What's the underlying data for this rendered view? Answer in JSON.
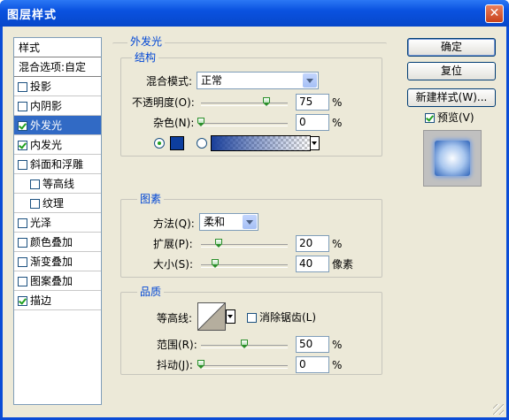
{
  "window": {
    "title": "图层样式",
    "close_glyph": "✕"
  },
  "left_panel": {
    "header": "样式",
    "blend_options": "混合选项:自定",
    "items": [
      {
        "label": "投影",
        "checked": false,
        "selected": false,
        "indent": false
      },
      {
        "label": "内阴影",
        "checked": false,
        "selected": false,
        "indent": false
      },
      {
        "label": "外发光",
        "checked": true,
        "selected": true,
        "indent": false
      },
      {
        "label": "内发光",
        "checked": true,
        "selected": false,
        "indent": false
      },
      {
        "label": "斜面和浮雕",
        "checked": false,
        "selected": false,
        "indent": false
      },
      {
        "label": "等高线",
        "checked": false,
        "selected": false,
        "indent": true
      },
      {
        "label": "纹理",
        "checked": false,
        "selected": false,
        "indent": true
      },
      {
        "label": "光泽",
        "checked": false,
        "selected": false,
        "indent": false
      },
      {
        "label": "颜色叠加",
        "checked": false,
        "selected": false,
        "indent": false
      },
      {
        "label": "渐变叠加",
        "checked": false,
        "selected": false,
        "indent": false
      },
      {
        "label": "图案叠加",
        "checked": false,
        "selected": false,
        "indent": false
      },
      {
        "label": "描边",
        "checked": true,
        "selected": false,
        "indent": false
      }
    ]
  },
  "outer_glow": {
    "title": "外发光",
    "structure": {
      "title": "结构",
      "blend_mode_label": "混合模式:",
      "blend_mode_value": "正常",
      "opacity_label": "不透明度(O):",
      "opacity_value": "75",
      "opacity_fraction": 0.75,
      "noise_label": "杂色(N):",
      "noise_value": "0",
      "noise_fraction": 0,
      "unit_percent": "%",
      "color_swatch": "#0d3e9e",
      "gradient_color": "#1a3f9a"
    },
    "elements": {
      "title": "图素",
      "technique_label": "方法(Q):",
      "technique_value": "柔和",
      "spread_label": "扩展(P):",
      "spread_value": "20",
      "spread_fraction": 0.2,
      "size_label": "大小(S):",
      "size_value": "40",
      "size_unit": "像素",
      "size_fraction": 0.16
    },
    "quality": {
      "title": "品质",
      "contour_label": "等高线:",
      "anti_alias_label": "消除锯齿(L)",
      "range_label": "范围(R):",
      "range_value": "50",
      "range_fraction": 0.5,
      "jitter_label": "抖动(J):",
      "jitter_value": "0",
      "jitter_fraction": 0
    }
  },
  "buttons": {
    "ok": "确定",
    "reset": "复位",
    "new_style": "新建样式(W)...",
    "preview_label": "预览(V)"
  },
  "colors": {
    "accent": "#0046d5",
    "titlebar": "#0a52e0",
    "selection": "#316ac5"
  }
}
